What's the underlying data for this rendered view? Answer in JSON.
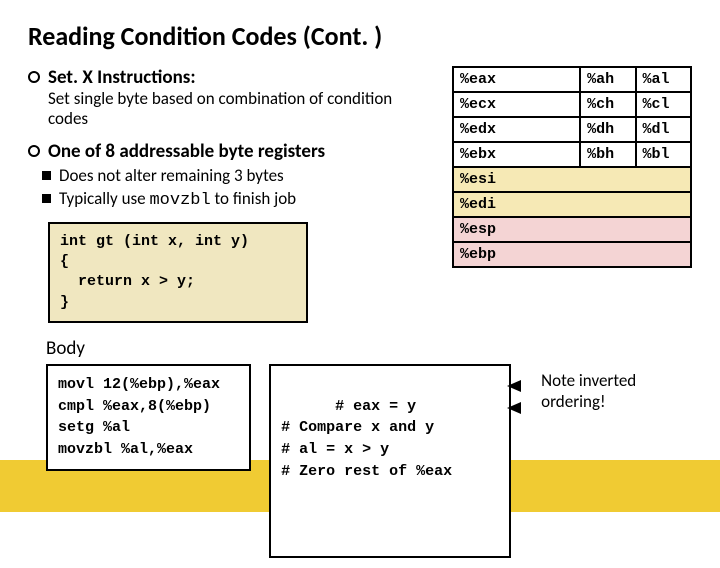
{
  "title": "Reading Condition Codes (Cont. )",
  "bullets": {
    "b1_title": "Set. X Instructions:",
    "b1_desc": "Set single byte based on combination of condition codes",
    "b2_title": "One of 8 addressable byte registers",
    "b2_sub1": "Does not alter remaining 3 bytes",
    "b2_sub2_a": "Typically use ",
    "b2_sub2_mono": "movzbl",
    "b2_sub2_b": " to finish job"
  },
  "codebox": "int gt (int x, int y)\n{\n  return x > y;\n}",
  "registers": [
    {
      "full": "%eax",
      "hi": "%ah",
      "lo": "%al",
      "cls": ""
    },
    {
      "full": "%ecx",
      "hi": "%ch",
      "lo": "%cl",
      "cls": ""
    },
    {
      "full": "%edx",
      "hi": "%dh",
      "lo": "%dl",
      "cls": ""
    },
    {
      "full": "%ebx",
      "hi": "%bh",
      "lo": "%bl",
      "cls": ""
    },
    {
      "full": "%esi",
      "cls": "yellow"
    },
    {
      "full": "%edi",
      "cls": "yellow"
    },
    {
      "full": "%esp",
      "cls": "pink"
    },
    {
      "full": "%ebp",
      "cls": "pink"
    }
  ],
  "body_label": "Body",
  "asm_left": "movl 12(%ebp),%eax\ncmpl %eax,8(%ebp)\nsetg %al\nmovzbl %al,%eax",
  "asm_right": "# eax = y\n# Compare x and y\n# al = x > y\n# Zero rest of %eax",
  "note": "Note inverted ordering!"
}
